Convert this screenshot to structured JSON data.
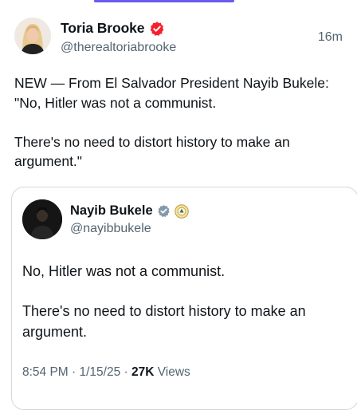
{
  "post": {
    "author_name": "Toria Brooke",
    "author_handle": "@therealtoriabrooke",
    "time_ago": "16m",
    "verified_badge_icon": "verified-badge-icon",
    "text_lines": [
      "NEW — From El Salvador President Nayib Bukele: \"No, Hitler was not a communist.",
      "There's no need to distort history to make an argument.\""
    ]
  },
  "quote": {
    "author_name": "Nayib Bukele",
    "author_handle": "@nayibbukele",
    "verified_badge_icon": "gray-verified-badge-icon",
    "affiliate_icon": "government-seal-icon",
    "text_lines": [
      "No, Hitler was not a communist.",
      "There's no need to distort history to make an argument."
    ],
    "timestamp": "8:54 PM · 1/15/25 · ",
    "views_count": "27K",
    "views_label": " Views"
  },
  "colors": {
    "accent_top": "#6b5cf0",
    "verified_badge": "#f4212e",
    "gray_badge": "#829aab",
    "secondary_text": "#536471"
  }
}
